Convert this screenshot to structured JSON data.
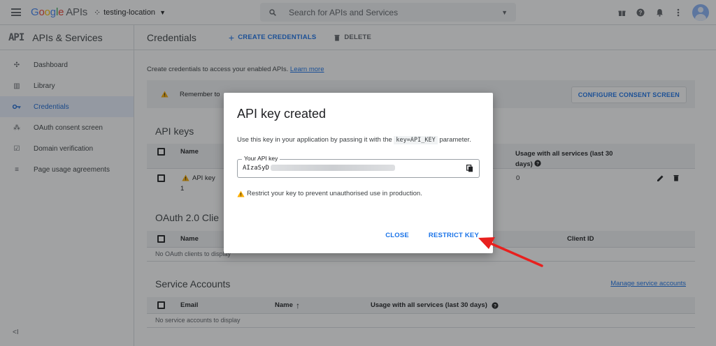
{
  "topbar": {
    "logo_google": "Google",
    "logo_apis": "APIs",
    "project": "testing-location",
    "search_placeholder": "Search for APIs and Services"
  },
  "sidebar": {
    "logo": "API",
    "title": "APIs & Services",
    "items": [
      {
        "label": "Dashboard",
        "icon": "dashboard-icon"
      },
      {
        "label": "Library",
        "icon": "library-icon"
      },
      {
        "label": "Credentials",
        "icon": "key-icon",
        "active": true
      },
      {
        "label": "OAuth consent screen",
        "icon": "consent-icon"
      },
      {
        "label": "Domain verification",
        "icon": "domain-icon"
      },
      {
        "label": "Page usage agreements",
        "icon": "settings-list-icon"
      }
    ],
    "collapse": "<I"
  },
  "main": {
    "title": "Credentials",
    "create_label": "CREATE CREDENTIALS",
    "delete_label": "DELETE",
    "intro_text": "Create credentials to access your enabled APIs.",
    "learn_more": "Learn more",
    "banner_text": "Remember to",
    "banner_button": "CONFIGURE CONSENT SCREEN",
    "api_keys": {
      "title": "API keys",
      "col_name": "Name",
      "col_usage_1": "Usage with all services (last 30",
      "col_usage_2": "days)",
      "row_name": "API key",
      "row_number": "1",
      "row_usage": "0"
    },
    "oauth": {
      "title": "OAuth 2.0 Clie",
      "col_name": "Name",
      "col_client_id": "Client ID",
      "empty": "No OAuth clients to display"
    },
    "service_accounts": {
      "title": "Service Accounts",
      "manage_link": "Manage service accounts",
      "col_email": "Email",
      "col_name": "Name",
      "col_usage": "Usage with all services (last 30 days)",
      "empty": "No service accounts to display"
    }
  },
  "dialog": {
    "title": "API key created",
    "text_before": "Use this key in your application by passing it with the",
    "code": "key=API_KEY",
    "text_after": "parameter.",
    "field_label": "Your API key",
    "key_prefix": "AIzaSyD",
    "warning": "Restrict your key to prevent unauthorised use in production.",
    "close_label": "CLOSE",
    "restrict_label": "RESTRICT KEY"
  },
  "colors": {
    "accent": "#1a73e8",
    "warning": "#f9ab00",
    "arrow": "#e8201e"
  }
}
